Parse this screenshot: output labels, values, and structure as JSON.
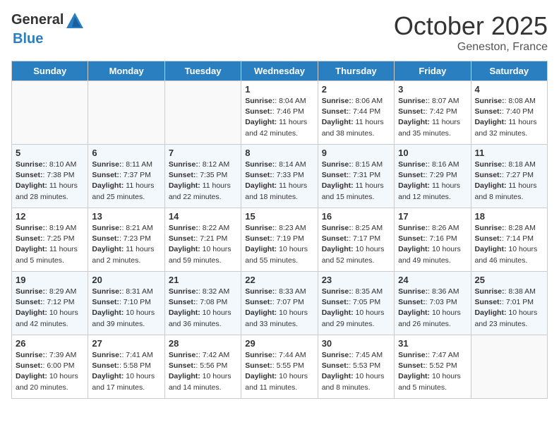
{
  "header": {
    "logo_general": "General",
    "logo_blue": "Blue",
    "month": "October 2025",
    "location": "Geneston, France"
  },
  "days_of_week": [
    "Sunday",
    "Monday",
    "Tuesday",
    "Wednesday",
    "Thursday",
    "Friday",
    "Saturday"
  ],
  "weeks": [
    [
      {
        "day": "",
        "info": ""
      },
      {
        "day": "",
        "info": ""
      },
      {
        "day": "",
        "info": ""
      },
      {
        "day": "1",
        "info": "Sunrise: 8:04 AM\nSunset: 7:46 PM\nDaylight: 11 hours and 42 minutes."
      },
      {
        "day": "2",
        "info": "Sunrise: 8:06 AM\nSunset: 7:44 PM\nDaylight: 11 hours and 38 minutes."
      },
      {
        "day": "3",
        "info": "Sunrise: 8:07 AM\nSunset: 7:42 PM\nDaylight: 11 hours and 35 minutes."
      },
      {
        "day": "4",
        "info": "Sunrise: 8:08 AM\nSunset: 7:40 PM\nDaylight: 11 hours and 32 minutes."
      }
    ],
    [
      {
        "day": "5",
        "info": "Sunrise: 8:10 AM\nSunset: 7:38 PM\nDaylight: 11 hours and 28 minutes."
      },
      {
        "day": "6",
        "info": "Sunrise: 8:11 AM\nSunset: 7:37 PM\nDaylight: 11 hours and 25 minutes."
      },
      {
        "day": "7",
        "info": "Sunrise: 8:12 AM\nSunset: 7:35 PM\nDaylight: 11 hours and 22 minutes."
      },
      {
        "day": "8",
        "info": "Sunrise: 8:14 AM\nSunset: 7:33 PM\nDaylight: 11 hours and 18 minutes."
      },
      {
        "day": "9",
        "info": "Sunrise: 8:15 AM\nSunset: 7:31 PM\nDaylight: 11 hours and 15 minutes."
      },
      {
        "day": "10",
        "info": "Sunrise: 8:16 AM\nSunset: 7:29 PM\nDaylight: 11 hours and 12 minutes."
      },
      {
        "day": "11",
        "info": "Sunrise: 8:18 AM\nSunset: 7:27 PM\nDaylight: 11 hours and 8 minutes."
      }
    ],
    [
      {
        "day": "12",
        "info": "Sunrise: 8:19 AM\nSunset: 7:25 PM\nDaylight: 11 hours and 5 minutes."
      },
      {
        "day": "13",
        "info": "Sunrise: 8:21 AM\nSunset: 7:23 PM\nDaylight: 11 hours and 2 minutes."
      },
      {
        "day": "14",
        "info": "Sunrise: 8:22 AM\nSunset: 7:21 PM\nDaylight: 10 hours and 59 minutes."
      },
      {
        "day": "15",
        "info": "Sunrise: 8:23 AM\nSunset: 7:19 PM\nDaylight: 10 hours and 55 minutes."
      },
      {
        "day": "16",
        "info": "Sunrise: 8:25 AM\nSunset: 7:17 PM\nDaylight: 10 hours and 52 minutes."
      },
      {
        "day": "17",
        "info": "Sunrise: 8:26 AM\nSunset: 7:16 PM\nDaylight: 10 hours and 49 minutes."
      },
      {
        "day": "18",
        "info": "Sunrise: 8:28 AM\nSunset: 7:14 PM\nDaylight: 10 hours and 46 minutes."
      }
    ],
    [
      {
        "day": "19",
        "info": "Sunrise: 8:29 AM\nSunset: 7:12 PM\nDaylight: 10 hours and 42 minutes."
      },
      {
        "day": "20",
        "info": "Sunrise: 8:31 AM\nSunset: 7:10 PM\nDaylight: 10 hours and 39 minutes."
      },
      {
        "day": "21",
        "info": "Sunrise: 8:32 AM\nSunset: 7:08 PM\nDaylight: 10 hours and 36 minutes."
      },
      {
        "day": "22",
        "info": "Sunrise: 8:33 AM\nSunset: 7:07 PM\nDaylight: 10 hours and 33 minutes."
      },
      {
        "day": "23",
        "info": "Sunrise: 8:35 AM\nSunset: 7:05 PM\nDaylight: 10 hours and 29 minutes."
      },
      {
        "day": "24",
        "info": "Sunrise: 8:36 AM\nSunset: 7:03 PM\nDaylight: 10 hours and 26 minutes."
      },
      {
        "day": "25",
        "info": "Sunrise: 8:38 AM\nSunset: 7:01 PM\nDaylight: 10 hours and 23 minutes."
      }
    ],
    [
      {
        "day": "26",
        "info": "Sunrise: 7:39 AM\nSunset: 6:00 PM\nDaylight: 10 hours and 20 minutes."
      },
      {
        "day": "27",
        "info": "Sunrise: 7:41 AM\nSunset: 5:58 PM\nDaylight: 10 hours and 17 minutes."
      },
      {
        "day": "28",
        "info": "Sunrise: 7:42 AM\nSunset: 5:56 PM\nDaylight: 10 hours and 14 minutes."
      },
      {
        "day": "29",
        "info": "Sunrise: 7:44 AM\nSunset: 5:55 PM\nDaylight: 10 hours and 11 minutes."
      },
      {
        "day": "30",
        "info": "Sunrise: 7:45 AM\nSunset: 5:53 PM\nDaylight: 10 hours and 8 minutes."
      },
      {
        "day": "31",
        "info": "Sunrise: 7:47 AM\nSunset: 5:52 PM\nDaylight: 10 hours and 5 minutes."
      },
      {
        "day": "",
        "info": ""
      }
    ]
  ]
}
